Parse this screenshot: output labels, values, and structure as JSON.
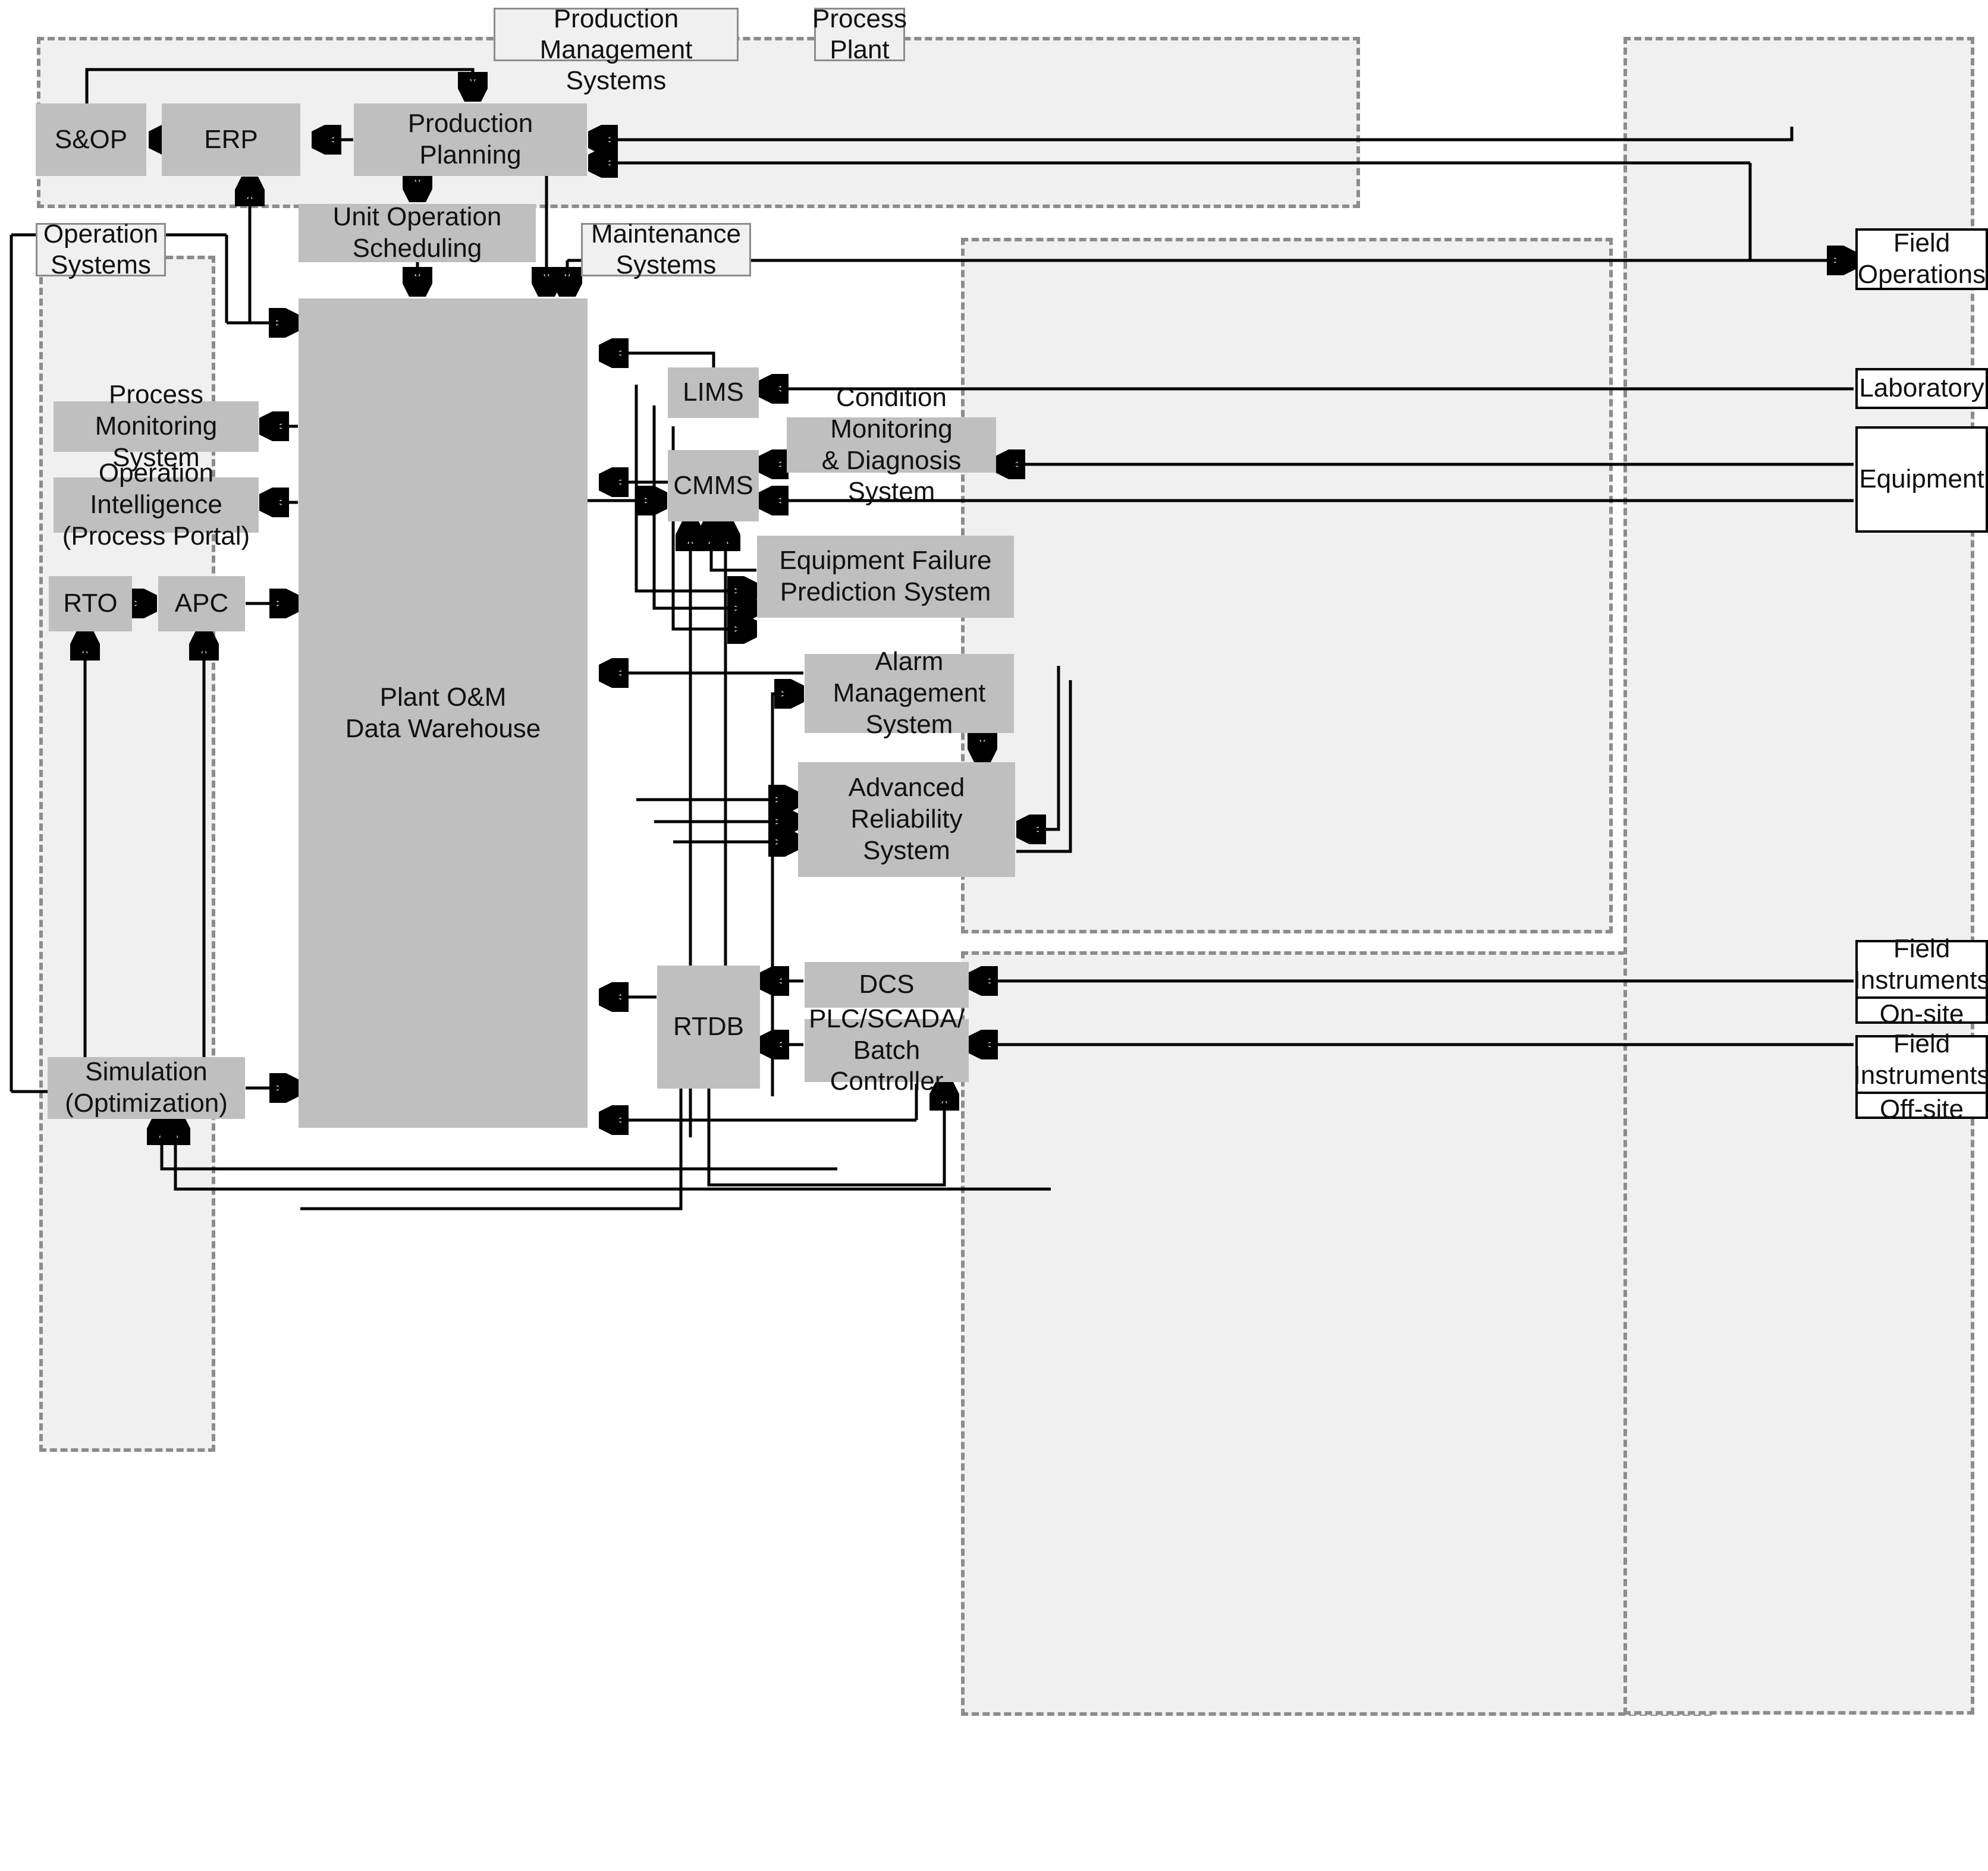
{
  "groups": {
    "rpms": {
      "label": "Resource and Production\nManagement Systems"
    },
    "operation": {
      "label": "Operation\nSystems"
    },
    "maintenance": {
      "label": "Maintenance\nSystems"
    },
    "plant": {
      "label": "Process\nPlant"
    }
  },
  "nodes": {
    "sop": {
      "label": "S&OP"
    },
    "erp": {
      "label": "ERP"
    },
    "production_planning": {
      "label": "Production Planning"
    },
    "unit_operation_scheduling": {
      "label": "Unit Operation\nScheduling"
    },
    "data_warehouse": {
      "label": "Plant O&M\nData Warehouse"
    },
    "process_monitoring": {
      "label": "Process Monitoring\nSystem"
    },
    "operation_intelligence": {
      "label": "Operation Intelligence\n(Process Portal)"
    },
    "rto": {
      "label": "RTO"
    },
    "apc": {
      "label": "APC"
    },
    "simulation": {
      "label": "Simulation\n(Optimization)"
    },
    "lims": {
      "label": "LIMS"
    },
    "cmms": {
      "label": "CMMS"
    },
    "condition_monitoring": {
      "label": "Condition Monitoring\n& Diagnosis System"
    },
    "equipment_failure": {
      "label": "Equipment Failure\nPrediction System"
    },
    "alarm_management": {
      "label": "Alarm Management\nSystem"
    },
    "advanced_reliability": {
      "label": "Advanced Reliability\nSystem"
    },
    "rtdb": {
      "label": "RTDB"
    },
    "dcs": {
      "label": "DCS"
    },
    "plc_scada": {
      "label": "PLC/SCADA/\nBatch Controller"
    }
  },
  "plant_nodes": {
    "field_operations": {
      "label": "Field\nOperations"
    },
    "laboratory": {
      "label": "Laboratory"
    },
    "equipment": {
      "label": "Equipment"
    },
    "field_instruments_onsite": {
      "title": "Field\nInstruments",
      "sub": "On-site"
    },
    "field_instruments_offsite": {
      "title": "Field\nInstruments",
      "sub": "Off-site"
    }
  },
  "colors": {
    "node_fill": "#bfbfbf",
    "group_fill": "#f0f0f0",
    "group_border": "#8c8c8c",
    "line": "#000000",
    "white_box": "#ffffff"
  }
}
